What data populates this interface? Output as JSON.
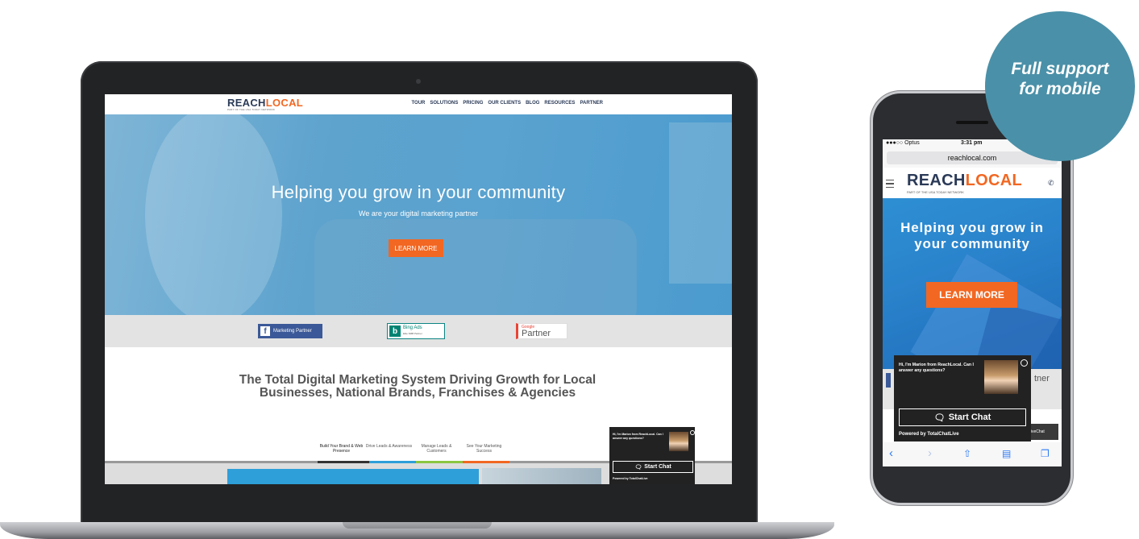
{
  "desktop": {
    "logo_main": "REACH",
    "logo_accent": "LOCAL",
    "logo_sub": "PART OF THE USA TODAY NETWORK",
    "nav": [
      "TOUR",
      "SOLUTIONS",
      "PRICING",
      "OUR CLIENTS",
      "BLOG",
      "RESOURCES",
      "PARTNER"
    ],
    "hero_title": "Helping you grow in your community",
    "hero_subtitle": "We are your digital marketing partner",
    "cta": "LEARN MORE",
    "partners": {
      "facebook": "Marketing Partner",
      "bing": "Bing Ads",
      "bing_sub": "Elite SMB Partner",
      "google_small": "Google",
      "google": "Partner"
    },
    "headline": "The Total Digital Marketing System Driving Growth for Local Businesses, National Brands, Franchises & Agencies",
    "tabs": [
      "Build Your Brand & Web Presence",
      "Drive Leads & Awareness",
      "Manage Leads & Customers",
      "See Your Marketing Success"
    ],
    "chat": {
      "greeting": "Hi, I'm Marion from ReachLocal. Can I answer any questions?",
      "button": "Start Chat",
      "powered": "Powered by TotalChatLive"
    }
  },
  "mobile": {
    "carrier": "●●●○○ Optus",
    "time": "3:31 pm",
    "url": "reachlocal.com",
    "logo_main": "REACH",
    "logo_accent": "LOCAL",
    "logo_sub": "PART OF THE USA TODAY NETWORK",
    "hero_title": "Helping you grow in your community",
    "cta": "LEARN MORE",
    "partner_fragment": "tner",
    "chat": {
      "greeting": "Hi, I'm Marion from ReachLocal. Can I answer any questions?",
      "button": "Start Chat",
      "powered": "Powered by TotalChatLive",
      "livechat": "alLiveChat"
    }
  },
  "badge": {
    "line1": "Full support",
    "line2": "for mobile"
  },
  "colors": {
    "brand_navy": "#2a3a57",
    "brand_orange": "#f26722",
    "badge": "#4a90a8"
  }
}
